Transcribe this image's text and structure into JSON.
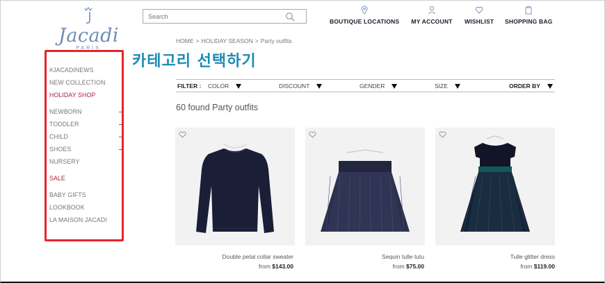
{
  "brand": {
    "name": "Jacadi",
    "sub": "PARIS"
  },
  "search": {
    "placeholder": "Search"
  },
  "topnav": {
    "boutique": "BOUTIQUE LOCATIONS",
    "account": "MY ACCOUNT",
    "wishlist": "WISHLIST",
    "bag": "SHOPPING BAG"
  },
  "breadcrumb": {
    "home": "HOME",
    "sep": ">",
    "season": "HOLIDAY SEASON",
    "current": "Party outfits"
  },
  "annotation": "카테고리 선택하기",
  "sidebar": {
    "items": [
      {
        "label": "#JACADINEWS"
      },
      {
        "label": "NEW COLLECTION"
      },
      {
        "label": "HOLIDAY SHOP"
      },
      {
        "label": "NEWBORN"
      },
      {
        "label": "TODDLER"
      },
      {
        "label": "CHILD"
      },
      {
        "label": "SHOES"
      },
      {
        "label": "NURSERY"
      },
      {
        "label": "SALE"
      },
      {
        "label": "BABY GIFTS"
      },
      {
        "label": "LOOKBOOK"
      },
      {
        "label": "LA MAISON JACADI"
      }
    ]
  },
  "filters": {
    "label": "FILTER :",
    "color": "COLOR",
    "discount": "DISCOUNT",
    "gender": "GENDER",
    "size": "SIZE",
    "orderby": "ORDER BY"
  },
  "results": {
    "count_text": "60 found Party outfits"
  },
  "products": [
    {
      "name": "Double petal collar sweater",
      "price_prefix": "from",
      "price": "$143.00"
    },
    {
      "name": "Sequin tulle tutu",
      "price_prefix": "from",
      "price": "$75.00"
    },
    {
      "name": "Tulle glitter dress",
      "price_prefix": "from",
      "price": "$119.00"
    }
  ],
  "colors": {
    "accent_red": "#a6243c",
    "annotation_blue": "#1b8bb4",
    "highlight_box": "#e8232a",
    "logo_blue": "#6f8cb5"
  }
}
